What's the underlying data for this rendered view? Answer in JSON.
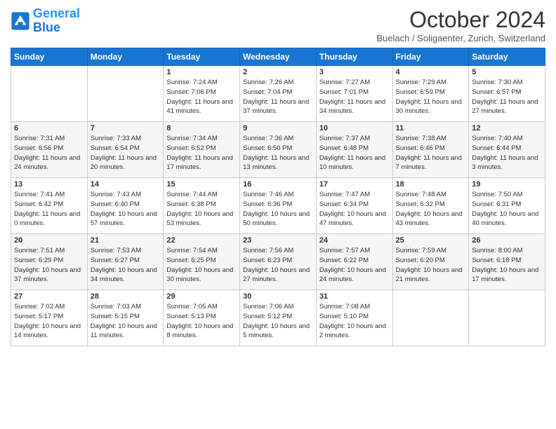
{
  "header": {
    "logo_line1": "General",
    "logo_line2": "Blue",
    "month": "October 2024",
    "location": "Buelach / Soligaenter, Zurich, Switzerland"
  },
  "days_of_week": [
    "Sunday",
    "Monday",
    "Tuesday",
    "Wednesday",
    "Thursday",
    "Friday",
    "Saturday"
  ],
  "weeks": [
    [
      {
        "day": "",
        "info": ""
      },
      {
        "day": "",
        "info": ""
      },
      {
        "day": "1",
        "info": "Sunrise: 7:24 AM\nSunset: 7:06 PM\nDaylight: 11 hours and 41 minutes."
      },
      {
        "day": "2",
        "info": "Sunrise: 7:26 AM\nSunset: 7:04 PM\nDaylight: 11 hours and 37 minutes."
      },
      {
        "day": "3",
        "info": "Sunrise: 7:27 AM\nSunset: 7:01 PM\nDaylight: 11 hours and 34 minutes."
      },
      {
        "day": "4",
        "info": "Sunrise: 7:29 AM\nSunset: 6:59 PM\nDaylight: 11 hours and 30 minutes."
      },
      {
        "day": "5",
        "info": "Sunrise: 7:30 AM\nSunset: 6:57 PM\nDaylight: 11 hours and 27 minutes."
      }
    ],
    [
      {
        "day": "6",
        "info": "Sunrise: 7:31 AM\nSunset: 6:56 PM\nDaylight: 11 hours and 24 minutes."
      },
      {
        "day": "7",
        "info": "Sunrise: 7:33 AM\nSunset: 6:54 PM\nDaylight: 11 hours and 20 minutes."
      },
      {
        "day": "8",
        "info": "Sunrise: 7:34 AM\nSunset: 6:52 PM\nDaylight: 11 hours and 17 minutes."
      },
      {
        "day": "9",
        "info": "Sunrise: 7:36 AM\nSunset: 6:50 PM\nDaylight: 11 hours and 13 minutes."
      },
      {
        "day": "10",
        "info": "Sunrise: 7:37 AM\nSunset: 6:48 PM\nDaylight: 11 hours and 10 minutes."
      },
      {
        "day": "11",
        "info": "Sunrise: 7:38 AM\nSunset: 6:46 PM\nDaylight: 11 hours and 7 minutes."
      },
      {
        "day": "12",
        "info": "Sunrise: 7:40 AM\nSunset: 6:44 PM\nDaylight: 11 hours and 3 minutes."
      }
    ],
    [
      {
        "day": "13",
        "info": "Sunrise: 7:41 AM\nSunset: 6:42 PM\nDaylight: 11 hours and 0 minutes."
      },
      {
        "day": "14",
        "info": "Sunrise: 7:43 AM\nSunset: 6:40 PM\nDaylight: 10 hours and 57 minutes."
      },
      {
        "day": "15",
        "info": "Sunrise: 7:44 AM\nSunset: 6:38 PM\nDaylight: 10 hours and 53 minutes."
      },
      {
        "day": "16",
        "info": "Sunrise: 7:46 AM\nSunset: 6:36 PM\nDaylight: 10 hours and 50 minutes."
      },
      {
        "day": "17",
        "info": "Sunrise: 7:47 AM\nSunset: 6:34 PM\nDaylight: 10 hours and 47 minutes."
      },
      {
        "day": "18",
        "info": "Sunrise: 7:48 AM\nSunset: 6:32 PM\nDaylight: 10 hours and 43 minutes."
      },
      {
        "day": "19",
        "info": "Sunrise: 7:50 AM\nSunset: 6:31 PM\nDaylight: 10 hours and 40 minutes."
      }
    ],
    [
      {
        "day": "20",
        "info": "Sunrise: 7:51 AM\nSunset: 6:29 PM\nDaylight: 10 hours and 37 minutes."
      },
      {
        "day": "21",
        "info": "Sunrise: 7:53 AM\nSunset: 6:27 PM\nDaylight: 10 hours and 34 minutes."
      },
      {
        "day": "22",
        "info": "Sunrise: 7:54 AM\nSunset: 6:25 PM\nDaylight: 10 hours and 30 minutes."
      },
      {
        "day": "23",
        "info": "Sunrise: 7:56 AM\nSunset: 6:23 PM\nDaylight: 10 hours and 27 minutes."
      },
      {
        "day": "24",
        "info": "Sunrise: 7:57 AM\nSunset: 6:22 PM\nDaylight: 10 hours and 24 minutes."
      },
      {
        "day": "25",
        "info": "Sunrise: 7:59 AM\nSunset: 6:20 PM\nDaylight: 10 hours and 21 minutes."
      },
      {
        "day": "26",
        "info": "Sunrise: 8:00 AM\nSunset: 6:18 PM\nDaylight: 10 hours and 17 minutes."
      }
    ],
    [
      {
        "day": "27",
        "info": "Sunrise: 7:02 AM\nSunset: 5:17 PM\nDaylight: 10 hours and 14 minutes."
      },
      {
        "day": "28",
        "info": "Sunrise: 7:03 AM\nSunset: 5:15 PM\nDaylight: 10 hours and 11 minutes."
      },
      {
        "day": "29",
        "info": "Sunrise: 7:05 AM\nSunset: 5:13 PM\nDaylight: 10 hours and 8 minutes."
      },
      {
        "day": "30",
        "info": "Sunrise: 7:06 AM\nSunset: 5:12 PM\nDaylight: 10 hours and 5 minutes."
      },
      {
        "day": "31",
        "info": "Sunrise: 7:08 AM\nSunset: 5:10 PM\nDaylight: 10 hours and 2 minutes."
      },
      {
        "day": "",
        "info": ""
      },
      {
        "day": "",
        "info": ""
      }
    ]
  ]
}
